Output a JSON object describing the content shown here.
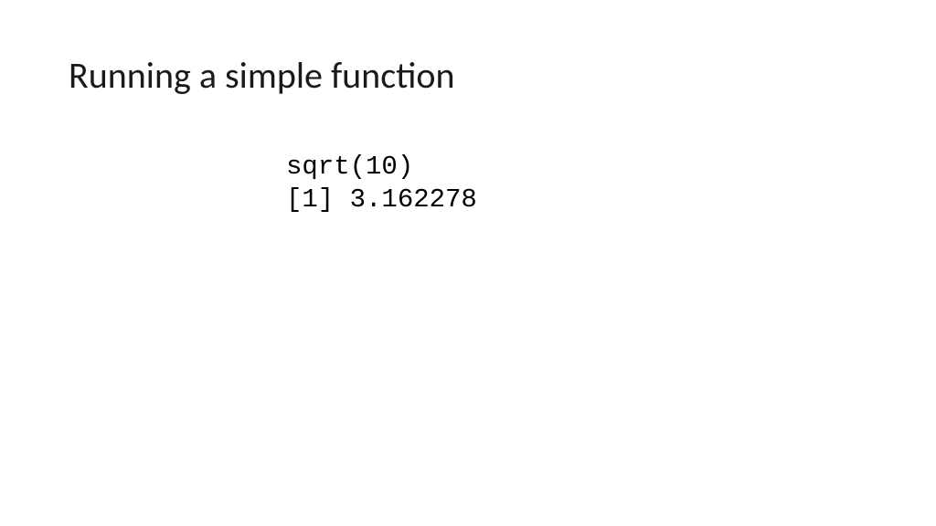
{
  "slide": {
    "title": "Running a simple function",
    "code": {
      "line1": "sqrt(10)",
      "line2": "[1] 3.162278"
    }
  }
}
